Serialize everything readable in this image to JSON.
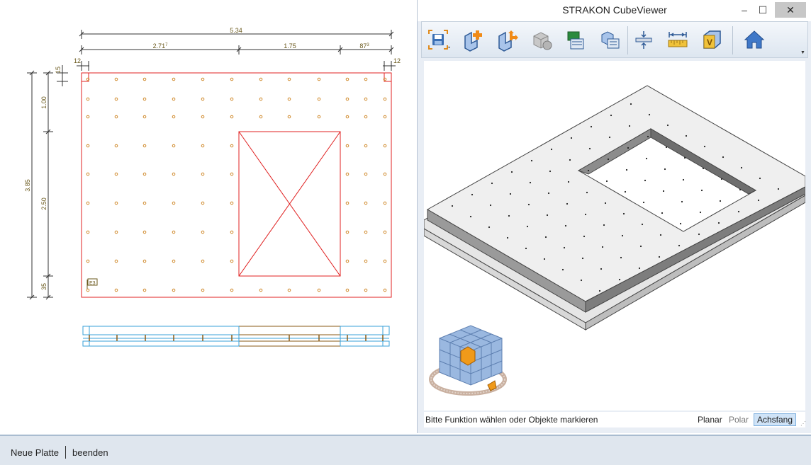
{
  "viewer": {
    "title": "STRAKON CubeViewer",
    "window_buttons": {
      "minimize": "–",
      "maximize": "☐",
      "close": "✕"
    },
    "toolbar": [
      {
        "name": "save-icon"
      },
      {
        "name": "add-object-icon"
      },
      {
        "name": "move-object-icon"
      },
      {
        "name": "object-settings-icon"
      },
      {
        "name": "import-icon"
      },
      {
        "name": "export-icon"
      },
      {
        "name": "section-icon"
      },
      {
        "name": "measure-icon"
      },
      {
        "name": "view-cube-icon"
      },
      {
        "name": "home-icon"
      }
    ],
    "status_text": "Bitte Funktion wählen oder Objekte markieren",
    "modes": {
      "planar": "Planar",
      "polar": "Polar",
      "achsfang": "Achsfang"
    }
  },
  "drawing": {
    "dimensions": {
      "top_total": "5.34",
      "top_seg1": "2.71",
      "top_seg1_sup": "7",
      "top_seg2": "1.75",
      "top_seg3": "87",
      "top_seg3_sup": "3",
      "left_offset": "12",
      "right_offset": "12",
      "left_total": "3.85",
      "left_seg1": "1.00",
      "left_seg2": "2.50",
      "left_seg3": "35",
      "left_small": "15"
    },
    "slab_tag": "E3"
  },
  "command_line": {
    "command": "Neue Platte",
    "option": "beenden"
  },
  "colors": {
    "slab_outline": "#e02020",
    "points": "#d08a2c",
    "dimension": "#6b5a1e",
    "section_blue": "#3aa0d8",
    "section_brown": "#8a5a16"
  }
}
